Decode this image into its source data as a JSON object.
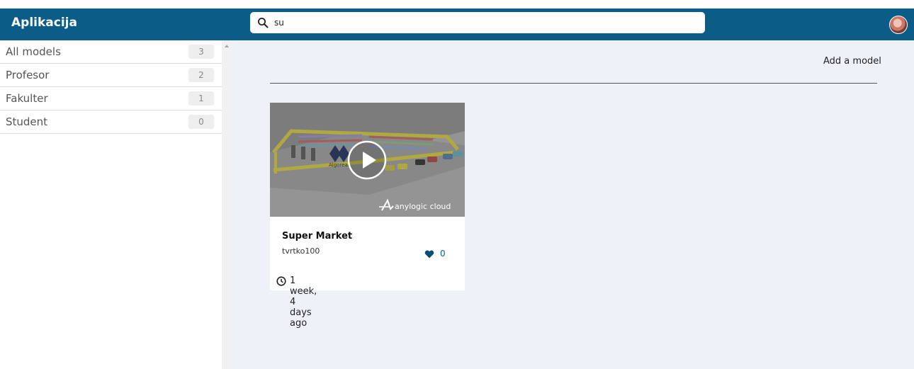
{
  "header": {
    "app_title": "Aplikacija",
    "search_value": "su",
    "brand_color": "#0b5c86"
  },
  "sidebar": {
    "items": [
      {
        "label": "All models",
        "count": "3"
      },
      {
        "label": "Profesor",
        "count": "2"
      },
      {
        "label": "Fakulter",
        "count": "1"
      },
      {
        "label": "Student",
        "count": "0"
      }
    ]
  },
  "main": {
    "add_model_label": "Add a model",
    "cards": [
      {
        "title": "Super Market",
        "author": "tvrtko100",
        "likes": "0",
        "time_ago": "1 week, 4 days ago",
        "thumbnail_watermark": "anylogic cloud",
        "thumbnail_sign": "Algoreal"
      }
    ]
  }
}
